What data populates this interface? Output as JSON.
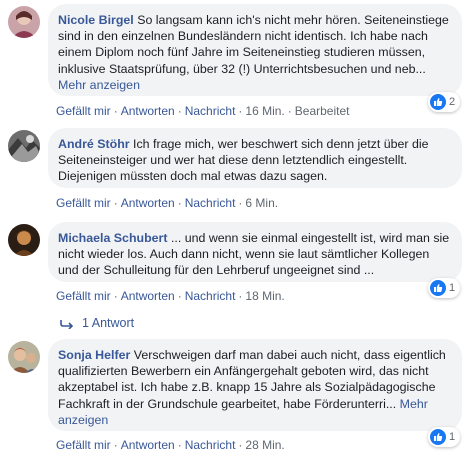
{
  "comments": [
    {
      "author": "Nicole Birgel",
      "text": "So langsam kann ich's nicht mehr hören. Seiteneinstiege sind in den einzelnen Bundesländern nicht identisch. Ich habe nach einem Diplom noch fünf Jahre im Seiteneinstieg studieren müssen, inklusive Staatsprüfung, über 32 (!) Unterrichtsbesuchen und neb...",
      "more_label": "Mehr anzeigen",
      "like_label": "Gefällt mir",
      "reply_label": "Antworten",
      "message_label": "Nachricht",
      "time": "16 Min.",
      "edited": "Bearbeitet",
      "reaction_count": "2",
      "reaction_icon": "like-icon"
    },
    {
      "author": "André Stöhr",
      "text": "Ich frage mich, wer beschwert sich denn jetzt über die Seiteneinsteiger und wer hat diese denn letztendlich eingestellt. Diejenigen müssten doch mal etwas dazu sagen.",
      "like_label": "Gefällt mir",
      "reply_label": "Antworten",
      "message_label": "Nachricht",
      "time": "6 Min."
    },
    {
      "author": "Michaela Schubert",
      "text": "... und wenn sie einmal eingestellt ist, wird man sie nicht wieder los. Auch dann nicht, wenn sie laut sämtlicher Kollegen und der Schulleitung für den Lehrberuf ungeeignet sind ...",
      "like_label": "Gefällt mir",
      "reply_label": "Antworten",
      "message_label": "Nachricht",
      "time": "18 Min.",
      "reaction_count": "1",
      "reaction_icon": "like-icon",
      "replies_label": "1 Antwort"
    },
    {
      "author": "Sonja Helfer",
      "text": "Verschweigen darf man dabei auch nicht, dass eigentlich qualifizierten Bewerbern ein Anfängergehalt geboten wird, das nicht akzeptabel ist. Ich habe z.B. knapp 15 Jahre als Sozialpädagogische Fachkraft in der Grundschule gearbeitet, habe Förderunterri...",
      "more_label": "Mehr anzeigen",
      "like_label": "Gefällt mir",
      "reply_label": "Antworten",
      "message_label": "Nachricht",
      "time": "28 Min.",
      "reaction_count": "1",
      "reaction_icon": "like-icon"
    }
  ],
  "colors": {
    "link": "#385898",
    "bubble": "#f2f3f5",
    "meta": "#606770",
    "like": "#1877f2"
  }
}
